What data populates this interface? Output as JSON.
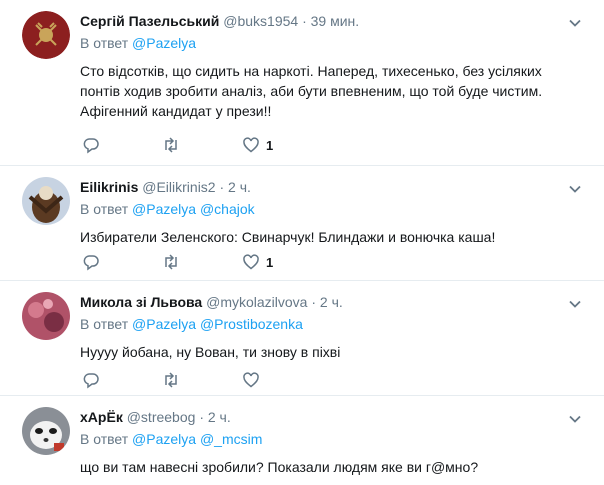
{
  "tweets": [
    {
      "name": "Сергій Пазельський",
      "handle": "@buks1954",
      "sep": "·",
      "time": "39 мин.",
      "reply_prefix": "В ответ",
      "mentions": [
        "@Pazelya"
      ],
      "text": "Сто відсотків, що сидить на наркоті. Наперед, тихесенько, без усіляких понтів ходив зробити аналіз, аби бути впевненим, що той буде чистим. Афігенний кандидат у прези!!",
      "like_count": "1"
    },
    {
      "name": "Eilikrinis",
      "handle": "@Eilikrinis2",
      "sep": "·",
      "time": "2 ч.",
      "reply_prefix": "В ответ",
      "mentions": [
        "@Pazelya",
        "@chajok"
      ],
      "text": "Избиратели Зеленского: Свинарчук! Блиндажи и вонючка каша!",
      "like_count": "1"
    },
    {
      "name": "Микола зі Львова",
      "handle": "@mykolazilvova",
      "sep": "·",
      "time": "2 ч.",
      "reply_prefix": "В ответ",
      "mentions": [
        "@Pazelya",
        "@Prostibozenka"
      ],
      "text": "Нуууу йобана, ну Вован, ти знову в піхві",
      "like_count": ""
    },
    {
      "name": "хАрЁк",
      "handle": "@streebog",
      "sep": "·",
      "time": "2 ч.",
      "reply_prefix": "В ответ",
      "mentions": [
        "@Pazelya",
        "@_mcsim"
      ],
      "text": "що ви там навесні зробили? Показали людям яке ви г@мно?",
      "like_count": ""
    }
  ],
  "icons": {
    "reply": "reply-icon",
    "retweet": "retweet-icon",
    "like": "like-icon",
    "more": "chevron-down-icon"
  },
  "colors": {
    "text": "#14171a",
    "muted": "#657786",
    "link": "#1da1f2",
    "divider": "#e6ecf0"
  }
}
